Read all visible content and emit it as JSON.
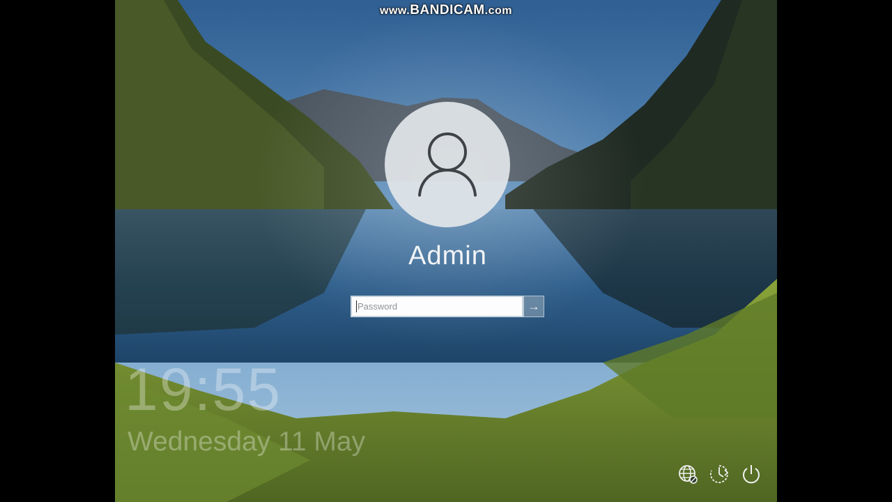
{
  "watermark": {
    "prefix": "www.",
    "brand": "BANDICAM",
    "suffix": ".com"
  },
  "lockscreen": {
    "username": "Admin",
    "password_placeholder": "Password",
    "submit_glyph": "→",
    "time": "19:55",
    "date": "Wednesday 11 May"
  },
  "tray_icons": [
    "network-icon",
    "accessibility-icon",
    "power-icon"
  ],
  "colors": {
    "sky": "#3e6f9c",
    "lake": "#2f5d86",
    "grass": "#7e9a32",
    "avatar_bg": "#e2e6e9"
  }
}
